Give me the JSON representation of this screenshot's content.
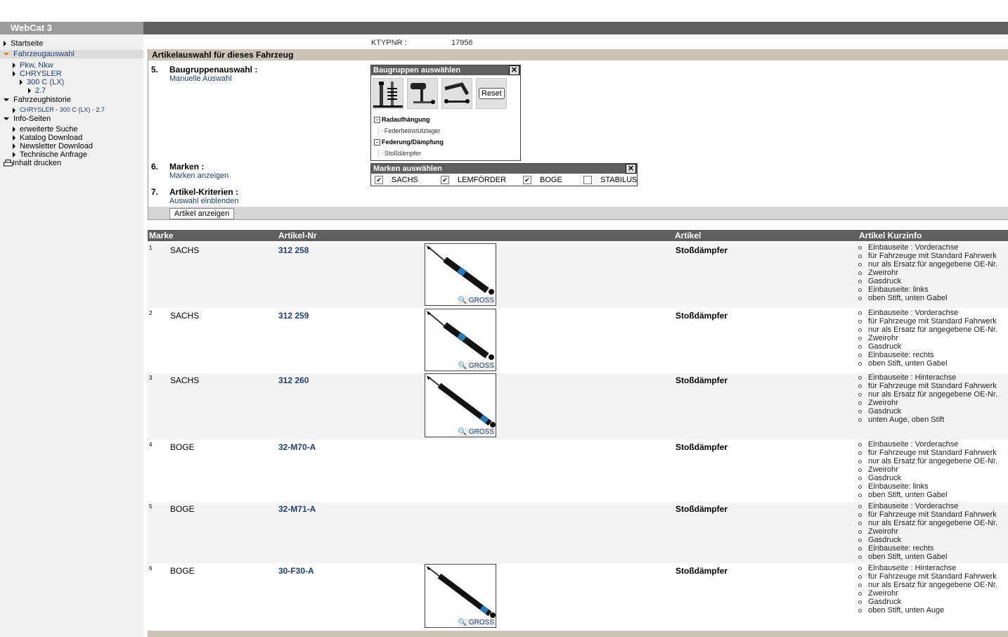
{
  "app": {
    "logo": "WebCat 3"
  },
  "sidebar": {
    "items": [
      {
        "label": "Startseite"
      },
      {
        "label": "Fahrzeugauswahl"
      },
      {
        "label": "Pkw, Nkw"
      },
      {
        "label": "CHRYSLER"
      },
      {
        "label": "300 C (LX)"
      },
      {
        "label": "2.7"
      },
      {
        "label": "Fahrzeughistorie"
      },
      {
        "label": "CHRYSLER - 300 C (LX) - 2.7"
      },
      {
        "label": "Info-Seiten"
      },
      {
        "label": "erweiterte Suche"
      },
      {
        "label": "Katalog Download"
      },
      {
        "label": "Newsletter Download"
      },
      {
        "label": "Technische Anfrage"
      },
      {
        "label": "Inhalt drucken"
      }
    ]
  },
  "vehicle": {
    "ktyp_label": "KTYPNR :",
    "ktyp_value": "17956"
  },
  "selection": {
    "heading": "Artikelauswahl für dieses Fahrzeug",
    "step5": {
      "num": "5.",
      "label": "Baugruppenauswahl :",
      "link": "Manuelle Auswahl"
    },
    "step6": {
      "num": "6.",
      "label": "Marken :",
      "link": "Marken anzeigen"
    },
    "step7": {
      "num": "7.",
      "label": "Artikel-Kriterien :",
      "link": "Auswahl einblenden"
    },
    "show_button": "Artikel anzeigen"
  },
  "groups_popup": {
    "title": "Baugruppen auswählen",
    "close": "✕",
    "reset": "Reset",
    "tree": [
      {
        "label": "Radaufhängung",
        "child": "Federbeinstützlager"
      },
      {
        "label": "Federung/Dämpfung",
        "child": "Stoßdämpfer"
      }
    ],
    "expander": "−"
  },
  "brands_popup": {
    "title": "Marken auswählen",
    "close": "✕",
    "brands": [
      {
        "label": "SACHS",
        "check": "✔"
      },
      {
        "label": "LEMFÖRDER",
        "check": "✔"
      },
      {
        "label": "BOGE",
        "check": "✔"
      },
      {
        "label": "STABILUS",
        "check": ""
      }
    ]
  },
  "table": {
    "headers": {
      "brand": "Marke",
      "number": "Artikel-Nr",
      "article": "Artikel",
      "info": "Artikel Kurzinfo"
    },
    "gross_label": "GROSS",
    "rows": [
      {
        "n": "1",
        "brand": "SACHS",
        "number": "312 258",
        "article": "Stoßdämpfer",
        "info": [
          "Einbauseite : Vorderachse",
          "für Fahrzeuge mit Standard Fahrwerk",
          "nur als Ersatz für angegebene OE-Nr.",
          "Zweirohr",
          "Gasdruck",
          "Einbauseite: links",
          "oben Stift, unten Gabel"
        ]
      },
      {
        "n": "2",
        "brand": "SACHS",
        "number": "312 259",
        "article": "Stoßdämpfer",
        "info": [
          "Einbauseite : Vorderachse",
          "für Fahrzeuge mit Standard Fahrwerk",
          "nur als Ersatz für angegebene OE-Nr.",
          "Zweirohr",
          "Gasdruck",
          "Einbauseite: rechts",
          "oben Stift, unten Gabel"
        ]
      },
      {
        "n": "3",
        "brand": "SACHS",
        "number": "312 260",
        "article": "Stoßdämpfer",
        "info": [
          "Einbauseite : Hinterachse",
          "für Fahrzeuge mit Standard Fahrwerk",
          "nur als Ersatz für angegebene OE-Nr.",
          "Zweirohr",
          "Gasdruck",
          "unten Auge, oben Stift"
        ]
      },
      {
        "n": "4",
        "brand": "BOGE",
        "number": "32-M70-A",
        "article": "Stoßdämpfer",
        "info": [
          "Einbauseite : Vorderachse",
          "für Fahrzeuge mit Standard Fahrwerk",
          "nur als Ersatz für angegebene OE-Nr.",
          "Zweirohr",
          "Gasdruck",
          "Einbauseite: links",
          "oben Stift, unten Gabel"
        ]
      },
      {
        "n": "5",
        "brand": "BOGE",
        "number": "32-M71-A",
        "article": "Stoßdämpfer",
        "info": [
          "Einbauseite : Vorderachse",
          "für Fahrzeuge mit Standard Fahrwerk",
          "nur als Ersatz für angegebene OE-Nr.",
          "Zweirohr",
          "Gasdruck",
          "Einbauseite: rechts",
          "oben Stift, unten Gabel"
        ]
      },
      {
        "n": "6",
        "brand": "BOGE",
        "number": "30-F30-A",
        "article": "Stoßdämpfer",
        "info": [
          "Einbauseite : Hinterachse",
          "für Fahrzeuge mit Standard Fahrwerk",
          "nur als Ersatz für angegebene OE-Nr.",
          "Zweirohr",
          "Gasdruck",
          "oben Stift, unten Auge"
        ]
      }
    ]
  },
  "colors": {
    "header_dark": "#5f5f5f",
    "section_tan": "#cdc3b7",
    "link_blue": "#1f3f6e",
    "accent_orange": "#e07f1a"
  }
}
